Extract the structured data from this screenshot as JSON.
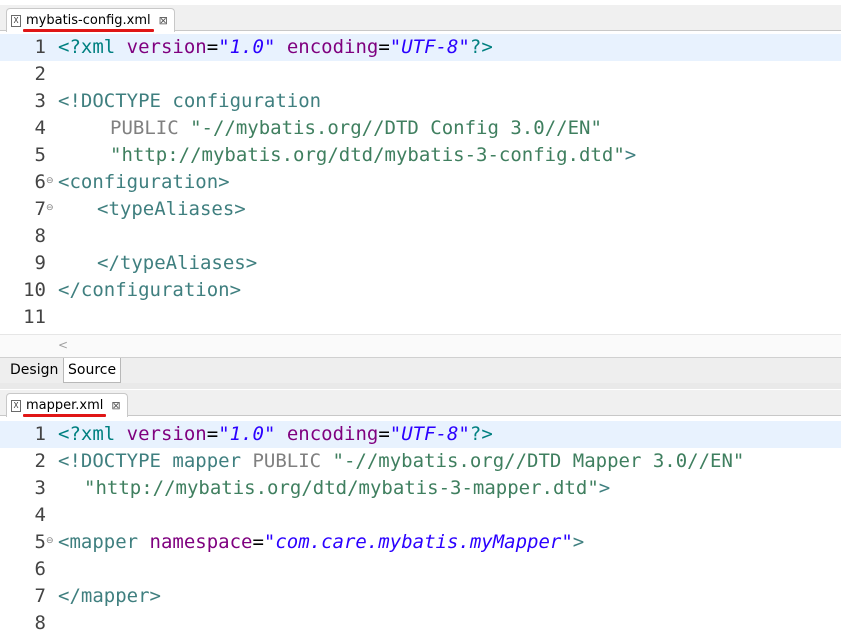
{
  "top_editor": {
    "tab_label": "mybatis-config.xml",
    "file_icon": "X",
    "lines": [
      {
        "n": "1",
        "fold": false,
        "current": true
      },
      {
        "n": "2",
        "fold": false
      },
      {
        "n": "3",
        "fold": false
      },
      {
        "n": "4",
        "fold": false
      },
      {
        "n": "5",
        "fold": false
      },
      {
        "n": "6",
        "fold": true
      },
      {
        "n": "7",
        "fold": true
      },
      {
        "n": "8",
        "fold": false
      },
      {
        "n": "9",
        "fold": false
      },
      {
        "n": "10",
        "fold": false
      },
      {
        "n": "11",
        "fold": false
      }
    ],
    "code": {
      "l1": {
        "open": "<?",
        "tag": "xml",
        "a1": " version",
        "eq1": "=",
        "v1": "\"1.0\"",
        "a2": " encoding",
        "eq2": "=",
        "v2": "\"UTF-8\"",
        "close": "?>"
      },
      "l3": {
        "decl": "<!DOCTYPE",
        "name": " configuration"
      },
      "l4": {
        "public": "PUBLIC",
        "id": " \"-//mybatis.org//DTD Config 3.0//EN\""
      },
      "l5": {
        "url": "\"http://mybatis.org/dtd/mybatis-3-config.dtd\"",
        "close": ">"
      },
      "l6": "<configuration>",
      "l7": "<typeAliases>",
      "l9": "</typeAliases>",
      "l10": "</configuration>"
    },
    "scroll_arrow": "<",
    "bottom_tabs": {
      "design": "Design",
      "source": "Source"
    }
  },
  "bottom_editor": {
    "tab_label": "mapper.xml",
    "file_icon": "X",
    "lines": [
      {
        "n": "1",
        "fold": false,
        "current": true
      },
      {
        "n": "2",
        "fold": false
      },
      {
        "n": "3",
        "fold": false
      },
      {
        "n": "4",
        "fold": false
      },
      {
        "n": "5",
        "fold": true
      },
      {
        "n": "6",
        "fold": false
      },
      {
        "n": "7",
        "fold": false
      },
      {
        "n": "8",
        "fold": false
      }
    ],
    "code": {
      "l1": {
        "open": "<?",
        "tag": "xml",
        "a1": " version",
        "eq1": "=",
        "v1": "\"1.0\"",
        "a2": " encoding",
        "eq2": "=",
        "v2": "\"UTF-8\"",
        "close": "?>"
      },
      "l2": {
        "decl": "<!DOCTYPE",
        "name": " mapper",
        "public": " PUBLIC",
        "id": " \"-//mybatis.org//DTD Mapper 3.0//EN\""
      },
      "l3": {
        "url": "\"http://mybatis.org/dtd/mybatis-3-mapper.dtd\"",
        "close": ">"
      },
      "l5": {
        "open": "<mapper",
        "attr": " namespace",
        "eq": "=",
        "val": "\"com.care.mybatis.myMapper\"",
        "close": ">"
      },
      "l7": "</mapper>"
    }
  },
  "close_glyph": "⊠",
  "fold_glyph": "⊖"
}
